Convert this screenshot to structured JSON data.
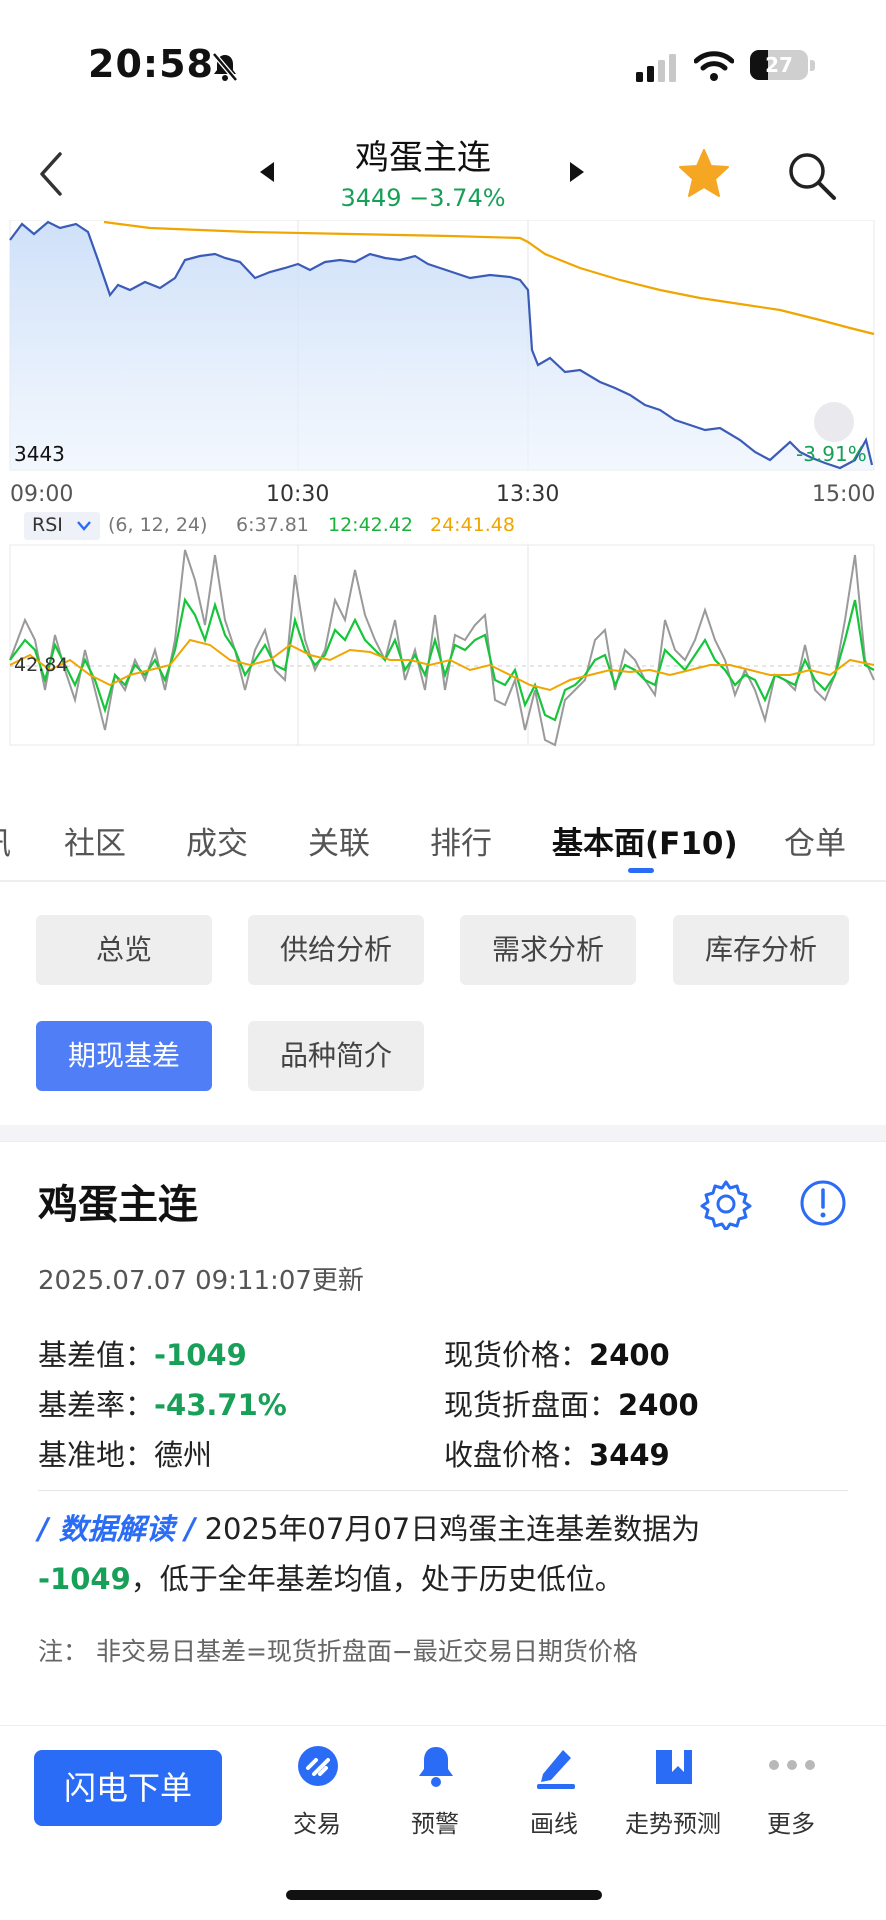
{
  "status_bar": {
    "time": "20:58",
    "battery": "27"
  },
  "header": {
    "title": "鸡蛋主连",
    "price": "3449",
    "change": "−3.74%"
  },
  "intraday": {
    "price_left_label": "3443",
    "pct_right_label": "-3.91%",
    "x_ticks": [
      "09:00",
      "10:30",
      "13:30",
      "15:00"
    ]
  },
  "rsi": {
    "indicator": "RSI",
    "params": "(6, 12, 24)",
    "rsi6": "6:37.81",
    "rsi12": "12:42.42",
    "rsi24": "24:41.48",
    "level_label": "42.84"
  },
  "tabs": [
    "讯",
    "社区",
    "成交",
    "关联",
    "排行",
    "基本面(F10)",
    "仓单"
  ],
  "chips": [
    "总览",
    "供给分析",
    "需求分析",
    "库存分析",
    "期现基差",
    "品种简介"
  ],
  "card": {
    "title": "鸡蛋主连",
    "updated": "2025.07.07 09:11:07更新",
    "basis_label": "基差值：",
    "basis_value": "-1049",
    "spot_label": "现货价格：",
    "spot_value": "2400",
    "basis_rate_label": "基差率：",
    "basis_rate_value": "-43.71%",
    "spot_conv_label": "现货折盘面：",
    "spot_conv_value": "2400",
    "base_label": "基准地：",
    "base_value": "德州",
    "close_label": "收盘价格：",
    "close_value": "3449",
    "interp_tag": "/ 数据解读 /",
    "interp_text": "2025年07月07日鸡蛋主连基差数据为",
    "interp_value": "-1049",
    "interp_text2": "，低于全年基差均值，处于历史低位。",
    "note": "注：  非交易日基差=现货折盘面−最近交易日期货价格"
  },
  "bottom_bar": {
    "flash_order": "闪电下单",
    "nav": [
      "交易",
      "预警",
      "画线",
      "走势预测",
      "更多"
    ]
  },
  "colors": {
    "accent": "#2a6cf6",
    "down": "#18a058",
    "avg_line": "#f0a500",
    "price_line": "#3a5bb8"
  }
}
